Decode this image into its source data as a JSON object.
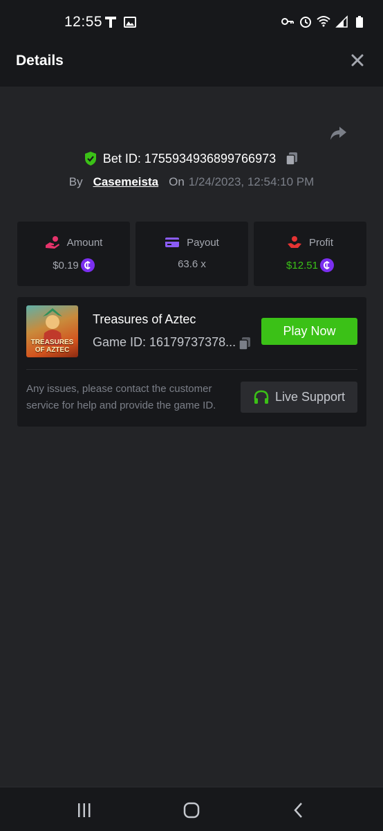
{
  "status_bar": {
    "time": "12:55",
    "left_icons": [
      "t-icon",
      "image-icon"
    ],
    "right_icons": [
      "key-icon",
      "alarm-icon",
      "wifi-icon",
      "signal-icon",
      "battery-icon"
    ]
  },
  "header": {
    "title": "Details",
    "close_icon": "close-icon"
  },
  "bet": {
    "share_icon": "share-icon",
    "verified_icon": "shield-check-icon",
    "bet_id_text": "Bet ID: 1755934936899766973",
    "by_label": "By",
    "username": "Casemeista",
    "on_label": "On",
    "date": "1/24/2023, 12:54:10 PM"
  },
  "stats": [
    {
      "label": "Amount",
      "value": "$0.19",
      "icon": "hand-coin-icon",
      "has_coin": true,
      "value_color": "#a5a8b0"
    },
    {
      "label": "Payout",
      "value": "63.6 x",
      "icon": "card-icon",
      "has_coin": false,
      "value_color": "#a5a8b0"
    },
    {
      "label": "Profit",
      "value": "$12.51",
      "icon": "profit-hand-icon",
      "has_coin": true,
      "value_color": "#3bc117"
    }
  ],
  "game": {
    "thumb_text_1": "TREASURES",
    "thumb_text_2": "OF AZTEC",
    "name": "Treasures of Aztec",
    "game_id_text": "Game ID: 16179737378...",
    "play_label": "Play Now",
    "help_text": "Any issues, please contact the customer service for help and provide the game ID.",
    "support_label": "Live Support"
  },
  "colors": {
    "background": "#232427",
    "panel": "#17181b",
    "accent_green": "#3bc117",
    "coin_purple": "#7b2ff0",
    "muted_text": "#a5a8b0"
  },
  "nav": [
    "recent-apps-icon",
    "home-icon",
    "back-icon"
  ]
}
